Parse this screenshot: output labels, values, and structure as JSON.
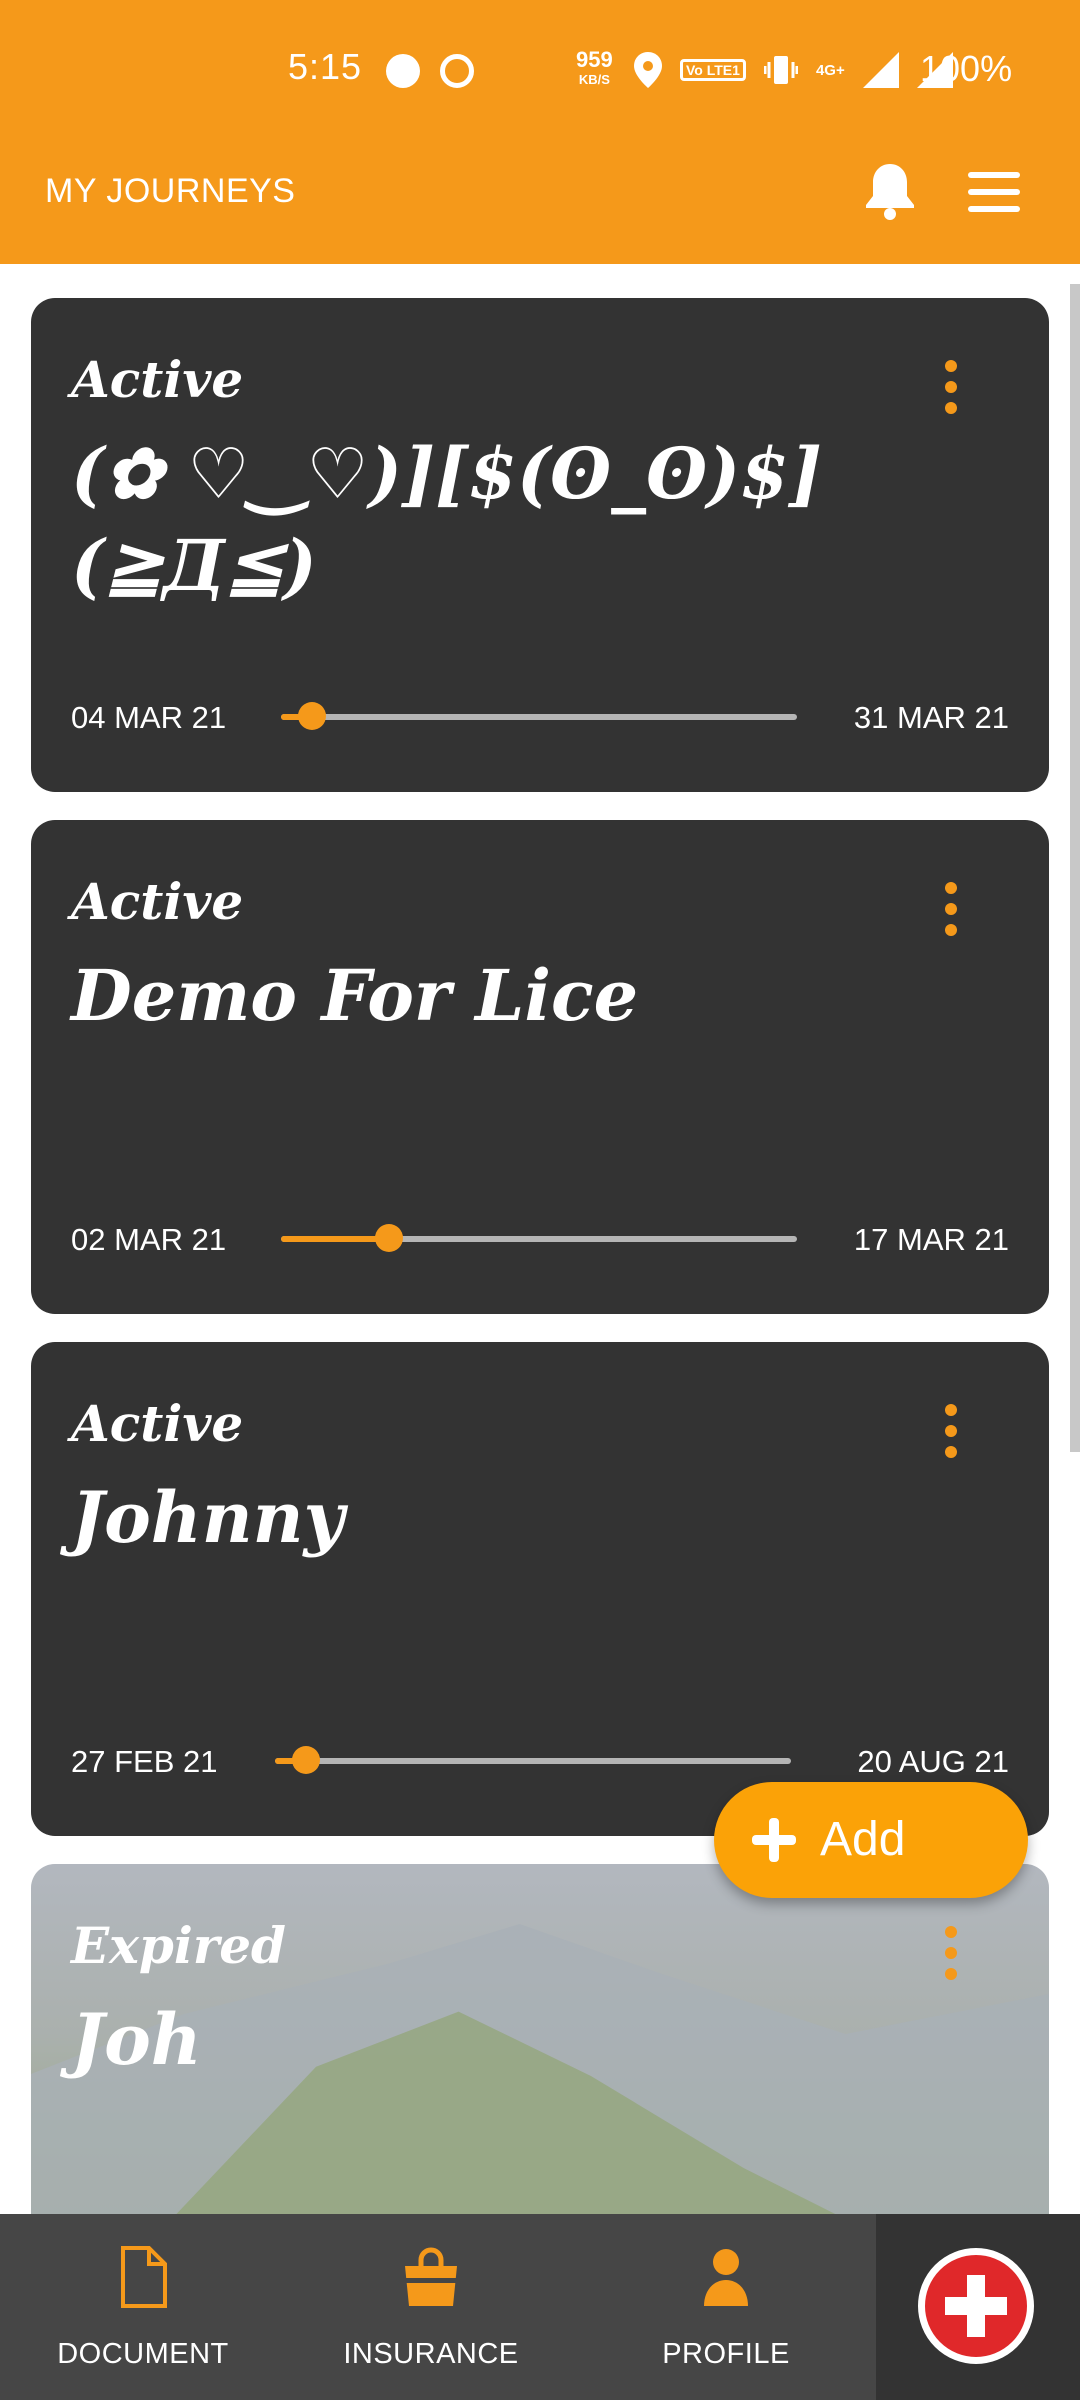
{
  "status_bar": {
    "time": "5:15",
    "net_speed_value": "959",
    "net_speed_unit": "KB/S",
    "volte": "Vo LTE1",
    "network": "4G+",
    "battery": "100%"
  },
  "app_bar": {
    "title": "MY JOURNEYS",
    "icons": [
      "bell-icon",
      "menu-icon"
    ]
  },
  "journeys": [
    {
      "status": "Active",
      "title": "(✿ ♡‿♡)][$(ʘ_ʘ)$](≧Д≦)",
      "start_date": "04 MAR 21",
      "end_date": "31 MAR 21",
      "progress": 0.06
    },
    {
      "status": "Active",
      "title": "Demo For Lice",
      "start_date": "02 MAR 21",
      "end_date": "17 MAR 21",
      "progress": 0.21
    },
    {
      "status": "Active",
      "title": "Johnny",
      "start_date": "27 FEB 21",
      "end_date": "20 AUG 21",
      "progress": 0.06
    },
    {
      "status": "Expired",
      "title": "Joh"
    }
  ],
  "fab": {
    "label": "Add"
  },
  "bottom_nav": {
    "items": [
      {
        "label": "DOCUMENT",
        "icon": "document-icon"
      },
      {
        "label": "INSURANCE",
        "icon": "shopping-bag-icon"
      },
      {
        "label": "PROFILE",
        "icon": "person-icon"
      }
    ],
    "emergency_icon": "red-cross-icon"
  },
  "colors": {
    "accent": "#F5991A",
    "card_bg": "#333333",
    "nav_bg": "#464646",
    "emergency": "#E0282A"
  }
}
